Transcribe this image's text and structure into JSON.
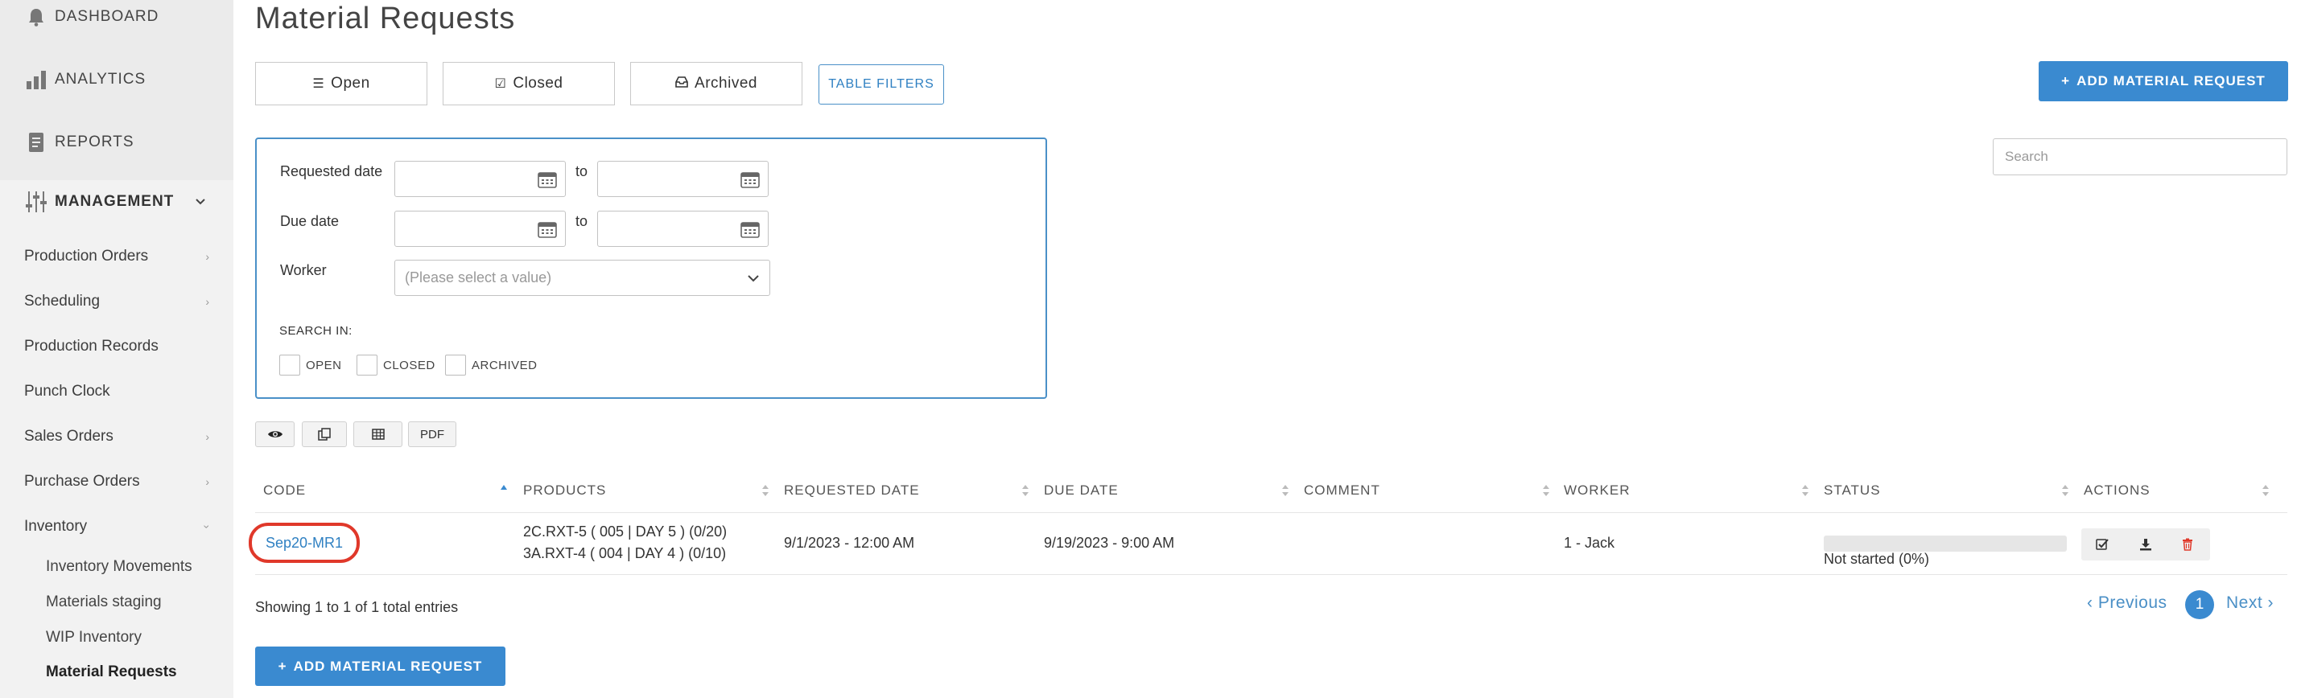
{
  "sidebar": {
    "top_items": [
      {
        "label": "DASHBOARD",
        "icon": "bell-icon"
      },
      {
        "label": "ANALYTICS",
        "icon": "bar-chart-icon"
      },
      {
        "label": "REPORTS",
        "icon": "reports-icon"
      }
    ],
    "management": {
      "label": "MANAGEMENT",
      "icon": "sliders-icon",
      "expanded": true
    },
    "items": [
      {
        "label": "Production Orders",
        "has_children": true
      },
      {
        "label": "Scheduling",
        "has_children": true
      },
      {
        "label": "Production Records",
        "has_children": false
      },
      {
        "label": "Punch Clock",
        "has_children": false
      },
      {
        "label": "Sales Orders",
        "has_children": true
      },
      {
        "label": "Purchase Orders",
        "has_children": true
      },
      {
        "label": "Inventory",
        "has_children": true,
        "expanded": true
      }
    ],
    "sub_items": [
      {
        "label": "Inventory Movements"
      },
      {
        "label": "Materials staging"
      },
      {
        "label": "WIP Inventory"
      },
      {
        "label": "Material Requests",
        "active": true
      }
    ]
  },
  "page": {
    "title": "Material Requests"
  },
  "tabs": [
    {
      "label": "Open",
      "icon": "list-icon"
    },
    {
      "label": "Closed",
      "icon": "check-square-icon"
    },
    {
      "label": "Archived",
      "icon": "archive-icon"
    }
  ],
  "table_filters_label": "TABLE FILTERS",
  "add_button_label": "ADD MATERIAL REQUEST",
  "search": {
    "placeholder": "Search"
  },
  "filters": {
    "requested_date_label": "Requested date",
    "due_date_label": "Due date",
    "worker_label": "Worker",
    "to_label": "to",
    "worker_placeholder": "(Please select a value)",
    "search_in_label": "SEARCH IN:",
    "search_in_options": [
      {
        "label": "OPEN",
        "checked": false
      },
      {
        "label": "CLOSED",
        "checked": false
      },
      {
        "label": "ARCHIVED",
        "checked": false
      }
    ]
  },
  "toolbar": {
    "pdf_label": "PDF",
    "icons": [
      "eye-icon",
      "copy-icon",
      "table-icon"
    ]
  },
  "table": {
    "columns": [
      "CODE",
      "PRODUCTS",
      "REQUESTED DATE",
      "DUE DATE",
      "COMMENT",
      "WORKER",
      "STATUS",
      "ACTIONS"
    ],
    "rows": [
      {
        "code": "Sep20-MR1",
        "products": [
          "2C.RXT-5 ( 005 | DAY 5 ) (0/20)",
          "3A.RXT-4 ( 004 | DAY 4 ) (0/10)"
        ],
        "requested_date": "9/1/2023 - 12:00 AM",
        "due_date": "9/19/2023 - 9:00 AM",
        "comment": "",
        "worker": "1 - Jack",
        "status": "Not started (0%)",
        "progress": 0
      }
    ]
  },
  "footer": {
    "showing": "Showing 1 to 1 of 1 total entries",
    "previous": "Previous",
    "next": "Next",
    "current_page": "1"
  },
  "colors": {
    "accent": "#3a8ad0",
    "highlight": "#e0382a"
  }
}
